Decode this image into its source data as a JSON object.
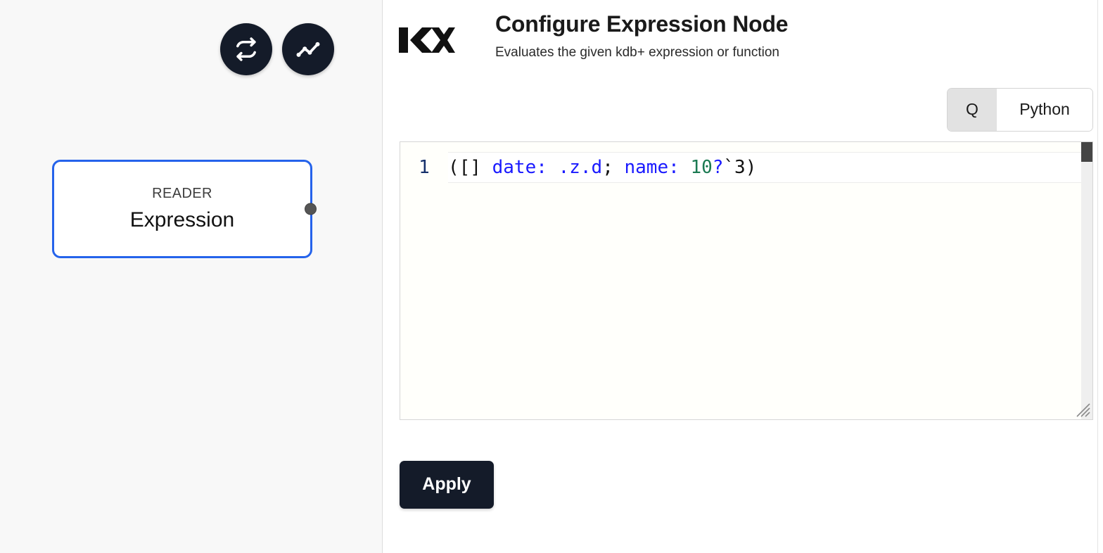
{
  "canvas": {
    "toolbar": [
      {
        "name": "refresh-icon",
        "label": "Refresh"
      },
      {
        "name": "activity-icon",
        "label": "Activity"
      }
    ],
    "node": {
      "kind": "READER",
      "title": "Expression",
      "border_color": "#2563eb",
      "port_color": "#555555"
    }
  },
  "config": {
    "logo": "KX",
    "title": "Configure Expression Node",
    "subtitle": "Evaluates the given kdb+ expression or function",
    "language": {
      "selected": "Q",
      "options": [
        "Q",
        "Python"
      ]
    },
    "editor": {
      "line_numbers": [
        "1"
      ],
      "code": "([] date: .z.d; name: 10?`3)",
      "tokens": [
        {
          "text": "([] ",
          "type": "plain"
        },
        {
          "text": "date:",
          "type": "key"
        },
        {
          "text": " ",
          "type": "plain"
        },
        {
          "text": ".z.d",
          "type": "key"
        },
        {
          "text": "; ",
          "type": "plain"
        },
        {
          "text": "name:",
          "type": "key"
        },
        {
          "text": " ",
          "type": "plain"
        },
        {
          "text": "10",
          "type": "num"
        },
        {
          "text": "?",
          "type": "op"
        },
        {
          "text": "`3)",
          "type": "plain"
        }
      ]
    },
    "apply_label": "Apply"
  }
}
